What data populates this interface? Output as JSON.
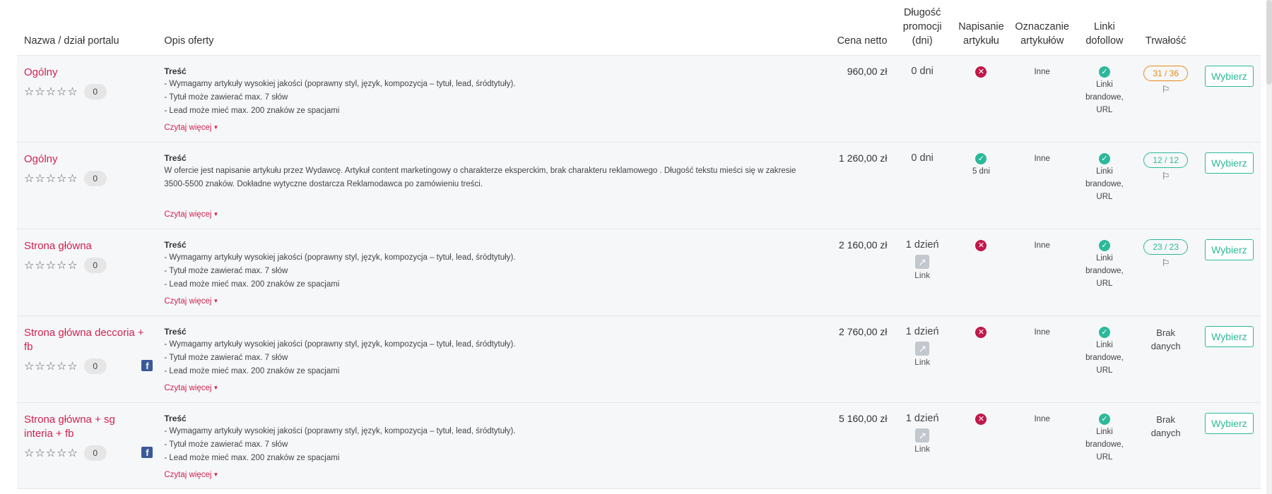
{
  "header": {
    "col_name": "Nazwa / dział portalu",
    "col_desc": "Opis oferty",
    "col_price": "Cena netto",
    "col_dur_1": "Długość",
    "col_dur_2": "promocji",
    "col_dur_3": "(dni)",
    "col_write_1": "Napisanie",
    "col_write_2": "artykułu",
    "col_mark_1": "Oznaczanie",
    "col_mark_2": "artykułów",
    "col_link_1": "Linki",
    "col_link_2": "dofollow",
    "col_trw": "Trwałość"
  },
  "common": {
    "stars": "☆☆☆☆☆",
    "count": "0",
    "desc_head": "Treść",
    "read_more": "Czytaj więcej",
    "mark": "Inne",
    "link_1": "Linki",
    "link_2": "brandowe,",
    "link_3": "URL",
    "select": "Wybierz",
    "link_label": "Link",
    "brak_1": "Brak",
    "brak_2": "danych"
  },
  "rows": [
    {
      "name": "Ogólny",
      "lines": [
        "- Wymagamy artykuły wysokiej jakości (poprawny styl, język, kompozycja – tytuł, lead, śródtytuły).",
        "- Tytuł może zawierać max. 7 słów",
        "- Lead może mieć max. 200 znaków ze spacjami"
      ],
      "price": "960,00 zł",
      "duration": "0 dni",
      "write_days": "",
      "trw": "31 / 36"
    },
    {
      "name": "Ogólny",
      "text": "W ofercie jest napisanie artykułu przez Wydawcę. Artykuł content marketingowy o charakterze eksperckim, brak charakteru reklamowego . Długość tekstu mieści się w zakresie 3500-5500 znaków. Dokładne wytyczne dostarcza Reklamodawca po zamówieniu treści.",
      "price": "1 260,00 zł",
      "duration": "0 dni",
      "write_days": "5 dni",
      "trw": "12 / 12"
    },
    {
      "name": "Strona główna",
      "lines": [
        "- Wymagamy artykuły wysokiej jakości (poprawny styl, język, kompozycja – tytuł, lead, śródtytuły).",
        "- Tytuł może zawierać max. 7 słów",
        "- Lead może mieć max. 200 znaków ze spacjami"
      ],
      "price": "2 160,00 zł",
      "duration": "1 dzień",
      "trw": "23 / 23"
    },
    {
      "name": "Strona główna deccoria + fb",
      "lines": [
        "- Wymagamy artykuły wysokiej jakości (poprawny styl, język, kompozycja – tytuł, lead, śródtytuły).",
        "- Tytuł może zawierać max. 7 słów",
        "- Lead może mieć max. 200 znaków ze spacjami"
      ],
      "price": "2 760,00 zł",
      "duration": "1 dzień"
    },
    {
      "name": "Strona główna + sg interia + fb",
      "lines": [
        "- Wymagamy artykuły wysokiej jakości (poprawny styl, język, kompozycja – tytuł, lead, śródtytuły).",
        "- Tytuł może zawierać max. 7 słów",
        "- Lead może mieć max. 200 znaków ze spacjami"
      ],
      "price": "5 160,00 zł",
      "duration": "1 dzień"
    }
  ],
  "icons": {
    "star": "star-outline-icon",
    "fb": "facebook-icon",
    "yes": "check-circle-icon",
    "no": "x-circle-icon",
    "link": "external-link-icon",
    "trw": "flag-icon"
  },
  "colors": {
    "link_red": "#d0224f",
    "green": "#2cb99a",
    "orange": "#e88a1a",
    "no_red": "#c0184a"
  }
}
